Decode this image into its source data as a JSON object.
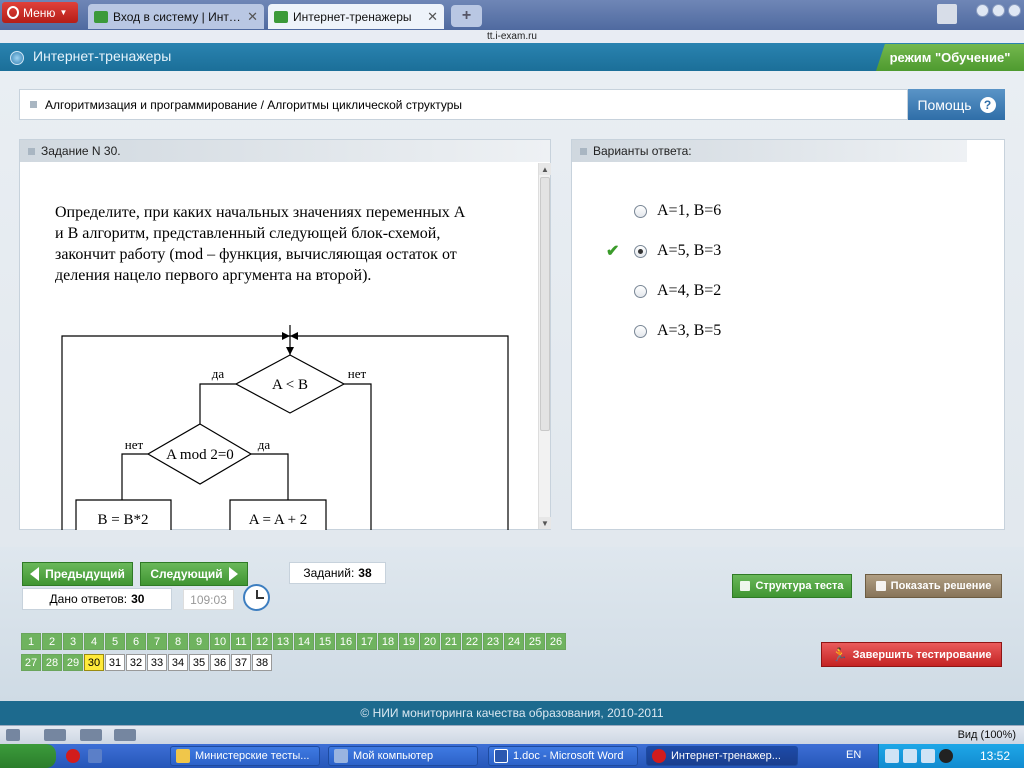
{
  "browser": {
    "menu_label": "Меню",
    "tabs": [
      {
        "label": "Вход в систему | Интер..."
      },
      {
        "label": "Интернет-тренажеры"
      }
    ],
    "url": "tt.i-exam.ru"
  },
  "app": {
    "title": "Интернет-тренажеры",
    "mode": "режим \"Обучение\""
  },
  "breadcrumb": "Алгоритмизация и программирование / Алгоритмы циклической структуры",
  "help_label": "Помощь",
  "task": {
    "header": "Задание N 30.",
    "text": "Определите, при каких начальных значениях переменных А и В алгоритм, представленный следующей блок-схемой, закончит работу (mod – функция, вычисляющая остаток от деления нацело первого аргумента на второй).",
    "flowchart": {
      "cond1": "A < B",
      "yes1": "да",
      "no1": "нет",
      "cond2": "A mod 2=0",
      "no2": "нет",
      "yes2": "да",
      "left_action": "B = B*2",
      "right_action": "A = A + 2"
    }
  },
  "answers": {
    "header": "Варианты ответа:",
    "options": [
      {
        "label": "A=1, B=6",
        "selected": false
      },
      {
        "label": "A=5, B=3",
        "selected": true,
        "checked_correct": true
      },
      {
        "label": "A=4, B=2",
        "selected": false
      },
      {
        "label": "A=3, B=5",
        "selected": false
      }
    ]
  },
  "controls": {
    "prev_label": "Предыдущий",
    "next_label": "Следующий",
    "total_label": "Заданий:",
    "total_value": "38",
    "answered_label": "Дано ответов:",
    "answered_value": "30",
    "timer": "109:03",
    "structure_label": "Структура теста",
    "solution_label": "Показать решение",
    "finish_label": "Завершить тестирование"
  },
  "question_numbers": {
    "row1": [
      "1",
      "2",
      "3",
      "4",
      "5",
      "6",
      "7",
      "8",
      "9",
      "10",
      "11",
      "12",
      "13",
      "14",
      "15",
      "16",
      "17",
      "18",
      "19",
      "20",
      "21",
      "22",
      "23",
      "24",
      "25",
      "26"
    ],
    "row2": [
      "27",
      "28",
      "29",
      "30",
      "31",
      "32",
      "33",
      "34",
      "35",
      "36",
      "37",
      "38"
    ],
    "answered_count": 29,
    "current": "30"
  },
  "footer": "© НИИ мониторинга качества образования, 2010-2011",
  "statusbar": {
    "zoom": "Вид (100%)"
  },
  "taskbar": {
    "items": [
      {
        "label": "Министерские тесты..."
      },
      {
        "label": "Мой компьютер"
      },
      {
        "label": "1.doc - Microsoft Word"
      },
      {
        "label": "Интернет-тренажер..."
      }
    ],
    "lang": "EN",
    "time": "13:52"
  },
  "colors": {
    "accent_green": "#4e9a2f",
    "finish_red": "#c42323",
    "header_blue": "#1b6f99",
    "current_question": "#ffea3a"
  }
}
